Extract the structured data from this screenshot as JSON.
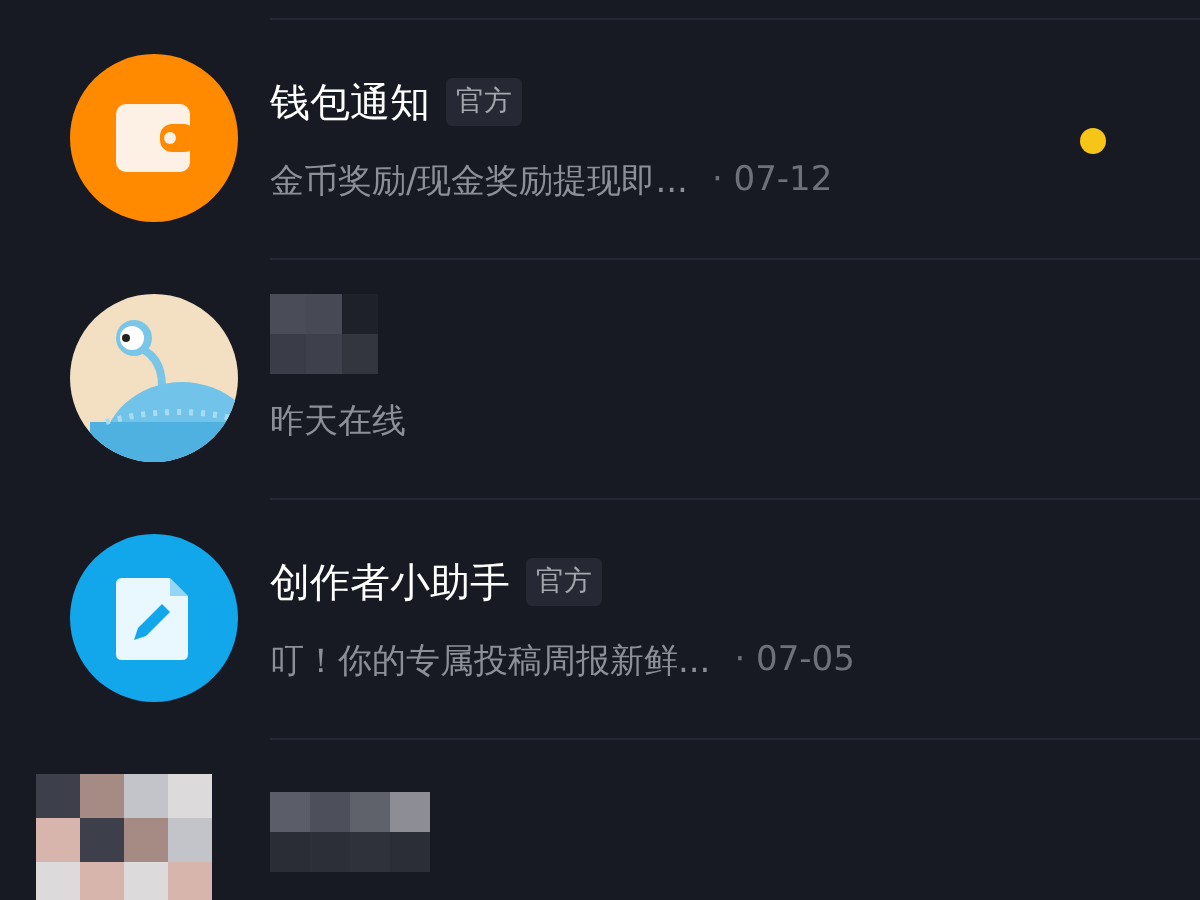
{
  "conversations": [
    {
      "kind": "wallet",
      "name": "钱包通知",
      "badge": "官方",
      "preview": "金币奖励/现金奖励提现即...",
      "date": "· 07-12",
      "unread": true,
      "color": "#f5c518"
    },
    {
      "kind": "cartoon",
      "preview": "昨天在线",
      "unread": false
    },
    {
      "kind": "editor",
      "name": "创作者小助手",
      "badge": "官方",
      "preview": "叮！你的专属投稿周报新鲜...",
      "date": "· 07-05",
      "unread": false
    },
    {
      "kind": "pixelated"
    }
  ]
}
